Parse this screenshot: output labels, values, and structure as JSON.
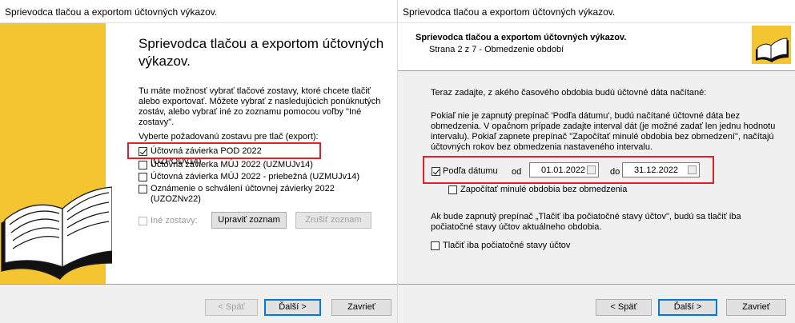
{
  "window1": {
    "title": "Sprievodca tlačou a exportom účtovných výkazov.",
    "heading": "Sprievodca tlačou a exportom účtovných výkazov.",
    "intro_lines": [
      "Tu máte možnosť vybrať tlačové zostavy, ktoré chcete tlačiť",
      "alebo exportovať. Môžete vybrať z nasledujúcich ponúknutých",
      "zostáv, alebo vybrať iné zo zoznamu pomocou voľby \"Iné",
      "zostavy\"."
    ],
    "select_label": "Vyberte požadovanú zostavu pre tlač (export):",
    "reports": [
      {
        "label": "Účtovná závierka POD 2022 (UZPODv14)",
        "checked": true
      },
      {
        "label": "Účtovná závierka MÚJ 2022 (UZMUJv14)",
        "checked": false
      },
      {
        "label": "Účtovná závierka MÚJ 2022 - priebežná (UZMUJv14)",
        "checked": false
      },
      {
        "label": "Oznámenie o schválení účtovnej závierky 2022 (UZOZNv22)",
        "checked": false
      }
    ],
    "other_reports": {
      "label": "Iné zostavy:",
      "checked": false,
      "enabled": false
    },
    "edit_list_button": "Upraviť zoznam",
    "cancel_list_button": "Zrušiť zoznam",
    "back_button": "< Späť",
    "next_button": "Ďalší >",
    "close_button": "Zavrieť",
    "accent_color": "#f5c531",
    "highlight_color": "#e0202a"
  },
  "window2": {
    "title": "Sprievodca tlačou a exportom účtovných výkazov.",
    "header_title": "Sprievodca tlačou a exportom účtovných výkazov.",
    "header_subtitle": "Strana 2 z 7 - Obmedzenie období",
    "instruction": "Teraz zadajte, z akého časového obdobia budú účtovné dáta načítané:",
    "explanation_lines": [
      "Pokiaľ nie je zapnutý prepínač 'Podľa dátumu', budú načítané účtovné dáta bez",
      "obmedzenia. V opačnom prípade zadajte interval dát (je možné zadať len jednu hodnotu",
      "intervalu). Pokiaľ zapnete prepínač \"Započítať minulé obdobia bez obmedzení\", načítajú",
      "účtovných rokov bez obmedzenia nastaveného intervalu."
    ],
    "by_date": {
      "label": "Podľa dátumu",
      "checked": true
    },
    "from_label": "od",
    "from_value": "01.01.2022",
    "to_label": "do",
    "to_value": "31.12.2022",
    "include_past": {
      "label": "Započítať minulé obdobia bez obmedzenia",
      "checked": false
    },
    "note_lines": [
      "Ak bude zapnutý prepínač „Tlačiť iba počiatočné stavy účtov\", budú sa tlačiť iba",
      "počiatočné stavy účtov aktuálneho obdobia."
    ],
    "initial_only": {
      "label": "Tlačiť iba počiatočné stavy účtov",
      "checked": false
    },
    "back_button": "< Späť",
    "next_button": "Ďalší >",
    "close_button": "Zavrieť"
  }
}
